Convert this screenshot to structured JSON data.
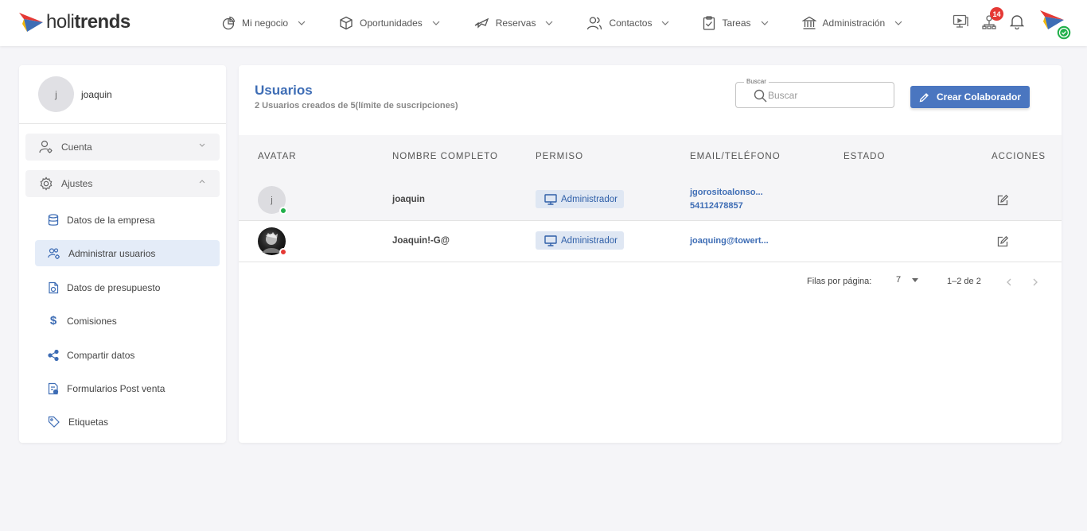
{
  "brand": {
    "name_light": "holi",
    "name_bold": "trends"
  },
  "nav": [
    {
      "label": "Mi negocio",
      "icon": "pie-chart-icon"
    },
    {
      "label": "Oportunidades",
      "icon": "box-icon"
    },
    {
      "label": "Reservas",
      "icon": "plane-icon"
    },
    {
      "label": "Contactos",
      "icon": "contacts-icon"
    },
    {
      "label": "Tareas",
      "icon": "clipboard-icon"
    },
    {
      "label": "Administración",
      "icon": "bank-icon"
    }
  ],
  "topbar": {
    "notification_count": "14"
  },
  "sidebar": {
    "user_initial": "j",
    "user_name": "joaquin",
    "sections": [
      {
        "label": "Cuenta",
        "expanded": false
      },
      {
        "label": "Ajustes",
        "expanded": true
      }
    ],
    "items": [
      {
        "label": "Datos de la empresa",
        "icon": "database-icon"
      },
      {
        "label": "Administrar usuarios",
        "icon": "users-gear-icon",
        "active": true
      },
      {
        "label": "Datos de presupuesto",
        "icon": "budget-doc-icon"
      },
      {
        "label": "Comisiones",
        "icon": "dollar-icon"
      },
      {
        "label": "Compartir datos",
        "icon": "share-icon"
      },
      {
        "label": "Formularios Post venta",
        "icon": "form-icon"
      },
      {
        "label": "Etiquetas",
        "icon": "tags-icon"
      }
    ]
  },
  "main": {
    "title": "Usuarios",
    "subtitle": "2 Usuarios creados de 5(límite de suscripciones)",
    "search": {
      "label": "Buscar",
      "placeholder": "Buscar"
    },
    "create_button": "Crear Colaborador",
    "columns": [
      "AVATAR",
      "NOMBRE COMPLETO",
      "PERMISO",
      "EMAIL/TELÉFONO",
      "ESTADO",
      "ACCIONES"
    ],
    "rows": [
      {
        "avatar_initial": "j",
        "name": "joaquin",
        "permission": "Administrador",
        "email": "jgorositoalonso...",
        "phone": "54112478857",
        "status_color": "#22b04b"
      },
      {
        "avatar_initial": "",
        "name": "Joaquin!-G@",
        "permission": "Administrador",
        "email": "joaquing@towert...",
        "phone": "",
        "status_color": "#e53935"
      }
    ],
    "pagination": {
      "rows_label": "Filas por página:",
      "rows_per_page": "7",
      "range": "1–2 de 2"
    }
  }
}
